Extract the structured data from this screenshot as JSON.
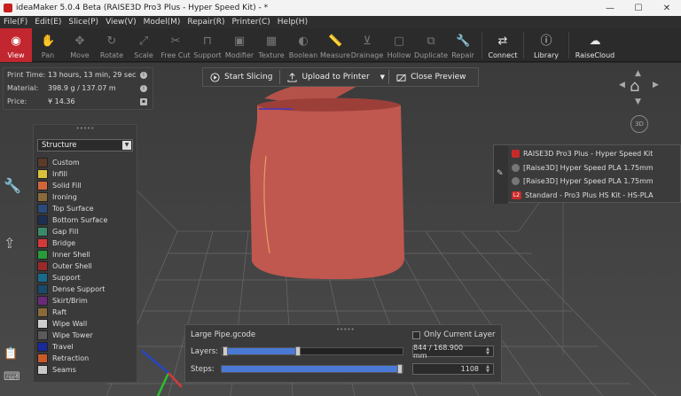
{
  "window": {
    "title": "ideaMaker 5.0.4 Beta (RAISE3D Pro3 Plus - Hyper Speed Kit) - *",
    "minimize": "—",
    "maximize": "☐",
    "close": "✕"
  },
  "menu": [
    "File(F)",
    "Edit(E)",
    "Slice(P)",
    "View(V)",
    "Model(M)",
    "Repair(R)",
    "Printer(C)",
    "Help(H)"
  ],
  "toolbar": {
    "view": "View",
    "pan": "Pan",
    "move": "Move",
    "rotate": "Rotate",
    "scale": "Scale",
    "free_cut": "Free Cut",
    "support": "Support",
    "modifier": "Modifier",
    "texture": "Texture",
    "boolean": "Boolean",
    "measure": "Measure",
    "drainage": "Drainage",
    "hollow": "Hollow",
    "duplicate": "Duplicate",
    "repair": "Repair",
    "connect": "Connect",
    "library": "Library",
    "raisecloud": "RaiseCloud"
  },
  "info": {
    "print_time_label": "Print Time:",
    "print_time": "13 hours, 13 min, 29 sec",
    "material_label": "Material:",
    "material": "398.9 g / 137.07 m",
    "price_label": "Price:",
    "price": "¥ 14.36"
  },
  "actions": {
    "start_slicing": "Start Slicing",
    "upload": "Upload to Printer",
    "close_preview": "Close Preview"
  },
  "structure": {
    "selected": "Structure",
    "items": [
      {
        "label": "Custom",
        "color": "#5a3a28"
      },
      {
        "label": "Infill",
        "color": "#d8c23a"
      },
      {
        "label": "Solid Fill",
        "color": "#d0663a"
      },
      {
        "label": "Ironing",
        "color": "#8a6a3a"
      },
      {
        "label": "Top Surface",
        "color": "#2a4a7a"
      },
      {
        "label": "Bottom Surface",
        "color": "#1e2e52"
      },
      {
        "label": "Gap Fill",
        "color": "#3a8a6a"
      },
      {
        "label": "Bridge",
        "color": "#d23a3a"
      },
      {
        "label": "Inner Shell",
        "color": "#2a9a3a"
      },
      {
        "label": "Outer Shell",
        "color": "#9a2a2a"
      },
      {
        "label": "Support",
        "color": "#1a6a8a"
      },
      {
        "label": "Dense Support",
        "color": "#1a4a6a"
      },
      {
        "label": "Skirt/Brim",
        "color": "#6a2a7a"
      },
      {
        "label": "Raft",
        "color": "#8a6a3a"
      },
      {
        "label": "Wipe Wall",
        "color": "#d0d0d0"
      },
      {
        "label": "Wipe Tower",
        "color": "#5a5a5a"
      },
      {
        "label": "Travel",
        "color": "#1a2a9a"
      },
      {
        "label": "Retraction",
        "color": "#c85a2a"
      },
      {
        "label": "Seams",
        "color": "#c8c8c8"
      }
    ]
  },
  "printer": {
    "items": [
      "RAISE3D Pro3 Plus - Hyper Speed Kit",
      "[Raise3D] Hyper Speed PLA 1.75mm",
      "[Raise3D] Hyper Speed PLA 1.75mm",
      "Standard - Pro3 Plus HS Kit - HS-PLA"
    ],
    "l2_badge": "L2"
  },
  "nav": {
    "view3d": "3D"
  },
  "layers": {
    "file": "Large Pipe.gcode",
    "only_current_label": "Only Current Layer",
    "layers_label": "Layers:",
    "layers_value": "844 / 168.900 mm",
    "layers_low": 0.02,
    "layers_high": 0.42,
    "steps_label": "Steps:",
    "steps_value": "1108",
    "steps_fill": 1.0
  }
}
